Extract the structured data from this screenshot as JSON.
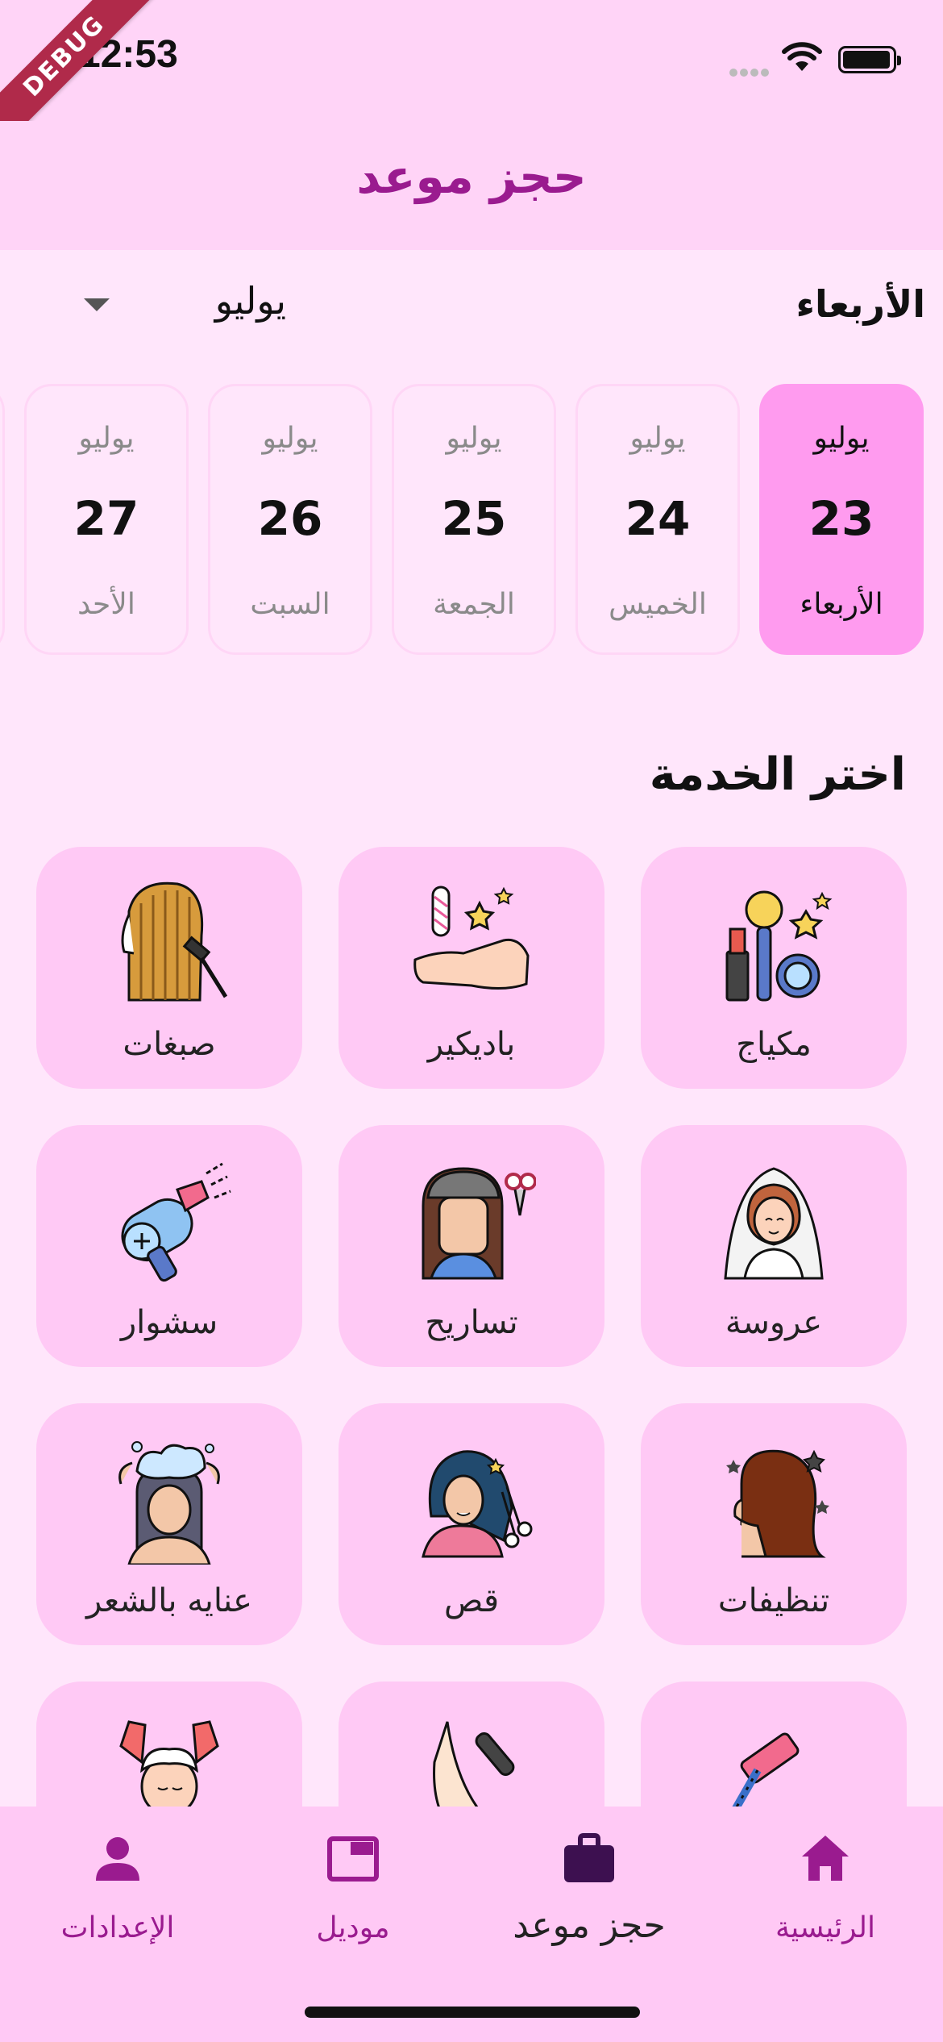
{
  "status_bar": {
    "time": "12:53",
    "debug_label": "DEBUG"
  },
  "header": {
    "title": "حجز موعد"
  },
  "date_selector": {
    "selected_day_name": "الأربعاء",
    "month_dropdown_value": "يوليو"
  },
  "days": [
    {
      "month": "يوليو",
      "date": "23",
      "weekday": "الأربعاء",
      "selected": true
    },
    {
      "month": "يوليو",
      "date": "24",
      "weekday": "الخميس",
      "selected": false
    },
    {
      "month": "يوليو",
      "date": "25",
      "weekday": "الجمعة",
      "selected": false
    },
    {
      "month": "يوليو",
      "date": "26",
      "weekday": "السبت",
      "selected": false
    },
    {
      "month": "يوليو",
      "date": "27",
      "weekday": "الأحد",
      "selected": false
    }
  ],
  "services_section": {
    "title": "اختر الخدمة",
    "items": [
      {
        "label": "مكياج",
        "icon": "makeup-icon"
      },
      {
        "label": "باديكير",
        "icon": "pedicure-hand-icon"
      },
      {
        "label": "صبغات",
        "icon": "hair-dye-icon"
      },
      {
        "label": "عروسة",
        "icon": "bride-icon"
      },
      {
        "label": "تساريح",
        "icon": "hairstyle-icon"
      },
      {
        "label": "سشوار",
        "icon": "hair-dryer-icon"
      },
      {
        "label": "تنظيفات",
        "icon": "facial-cleaning-icon"
      },
      {
        "label": "قص",
        "icon": "haircut-icon"
      },
      {
        "label": "عنايه بالشعر",
        "icon": "hair-care-icon"
      },
      {
        "label": "",
        "icon": "waxing-icon"
      },
      {
        "label": "",
        "icon": "foot-care-icon"
      },
      {
        "label": "",
        "icon": "massage-icon"
      }
    ]
  },
  "bottom_nav": {
    "items": [
      {
        "label": "الرئيسية",
        "icon": "home-icon",
        "active": false
      },
      {
        "label": "حجز موعد",
        "icon": "briefcase-icon",
        "active": true
      },
      {
        "label": "موديل",
        "icon": "gallery-icon",
        "active": false
      },
      {
        "label": "الإعدادات",
        "icon": "person-icon",
        "active": false
      }
    ]
  },
  "colors": {
    "primary": "#9a1b8f",
    "header_bg": "#ffd4f7",
    "page_bg": "#ffe6fb",
    "card_bg": "#ffc9f5",
    "selected_day_bg": "#ff9bef"
  }
}
